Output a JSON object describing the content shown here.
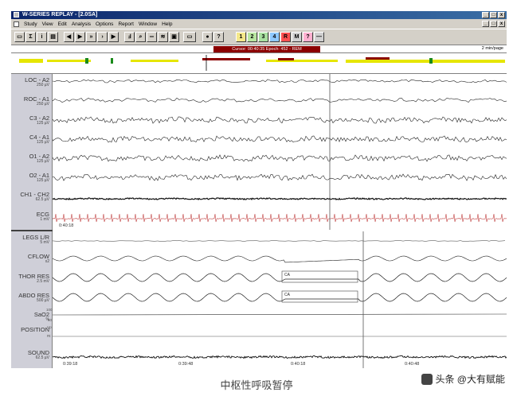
{
  "window": {
    "title": "W-SERIES REPLAY - [2.0SA]",
    "controls": [
      "_",
      "□",
      "x"
    ],
    "doc_controls": [
      "_",
      "□",
      "x"
    ]
  },
  "menu": [
    "Study",
    "View",
    "Edit",
    "Analysis",
    "Options",
    "Report",
    "Window",
    "Help"
  ],
  "toolbar": {
    "stage_buttons": [
      "1",
      "2",
      "3",
      "4",
      "R",
      "M",
      "?",
      "—"
    ],
    "stage_colors": [
      "#f5e88a",
      "#b8e6a0",
      "#a8e0a0",
      "#8ec8ff",
      "#ff5050",
      "#d0d0d0",
      "#ffb0d0",
      "#d0d0d0"
    ]
  },
  "status": {
    "cursor": "Cursor: 00:40:35 Epoch: 452 - REM",
    "page_size": "2 min/page"
  },
  "channels_top": [
    {
      "name": "LOC - A2",
      "scale": "250 µV"
    },
    {
      "name": "ROC - A1",
      "scale": "250 µV"
    },
    {
      "name": "C3 - A2",
      "scale": "125 µV"
    },
    {
      "name": "C4 - A1",
      "scale": "125 µV"
    },
    {
      "name": "O1 - A2",
      "scale": "125 µV"
    },
    {
      "name": "O2 - A1",
      "scale": "125 µV"
    },
    {
      "name": "CH1 - CH2",
      "scale": "62.5 µV"
    },
    {
      "name": "ECG",
      "scale": "1 mV"
    }
  ],
  "top_time": "0:40:18",
  "channels_bottom": [
    {
      "name": "LEGS L/R",
      "scale": "5 mV"
    },
    {
      "name": "CFLOW",
      "scale": "x2"
    },
    {
      "name": "THOR RES",
      "scale": "2.5 mV"
    },
    {
      "name": "ABDO RES",
      "scale": "500 µV"
    },
    {
      "name": "SaO2",
      "scale": "%"
    },
    {
      "name": "POSITION",
      "scale": ""
    },
    {
      "name": "SOUND",
      "scale": "62.5 µV"
    }
  ],
  "sao2_ticks": [
    "100",
    "50"
  ],
  "position_ticks": [
    "Up",
    "Rt"
  ],
  "annotations": [
    "CA",
    "CA"
  ],
  "time_axis": [
    "0:39:18",
    "0:39:48",
    "0:40:18",
    "0:40:48"
  ],
  "caption": "中枢性呼吸暂停",
  "watermark": "头条 @大有赋能",
  "colors": {
    "ecg": "#c04040",
    "title_bar": "#0a246a",
    "cursor_info": "#8b0000"
  }
}
